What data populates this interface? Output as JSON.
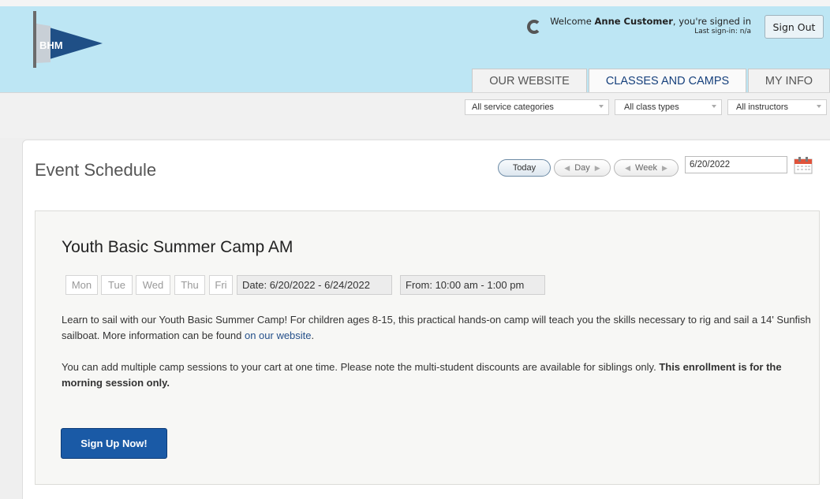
{
  "header": {
    "logo_text": "BHM",
    "welcome_prefix": "Welcome",
    "user_name": "Anne Customer",
    "welcome_suffix": ", you're signed in",
    "last_signin": "Last sign-in: n/a",
    "sign_out_label": "Sign Out",
    "colors": {
      "header_bg": "#bde6f4",
      "accent": "#16407c"
    }
  },
  "tabs": [
    {
      "label": "OUR WEBSITE",
      "active": false
    },
    {
      "label": "CLASSES AND CAMPS",
      "active": true
    },
    {
      "label": "MY INFO",
      "active": false
    }
  ],
  "filters": {
    "service_categories": "All service categories",
    "class_types": "All class types",
    "instructors": "All instructors"
  },
  "schedule": {
    "title": "Event Schedule",
    "today_label": "Today",
    "day_label": "Day",
    "week_label": "Week",
    "date_value": "6/20/2022",
    "calendar_icon": "calendar-icon"
  },
  "event": {
    "title": "Youth Basic Summer Camp AM",
    "days": [
      "Mon",
      "Tue",
      "Wed",
      "Thu",
      "Fri"
    ],
    "date_label": "Date:",
    "date_range": "6/20/2022 - 6/24/2022",
    "from_label": "From:",
    "time_range": "10:00 am - 1:00 pm",
    "desc1_text": "Learn to sail with our Youth Basic Summer Camp! For children ages 8-15, this practical hands-on camp will teach you the skills necessary to rig and sail a 14' Sunfish sailboat. More information can be found ",
    "desc1_link": "on our website",
    "desc1_end": ".",
    "desc2_text": "You can add multiple camp sessions to your cart at one time. Please note the multi-student discounts are available for siblings only. ",
    "desc2_bold": "This enrollment is for the morning session only.",
    "signup_label": "Sign Up Now!",
    "colors": {
      "signup_bg": "#1a5aa6",
      "link": "#25508a"
    }
  }
}
